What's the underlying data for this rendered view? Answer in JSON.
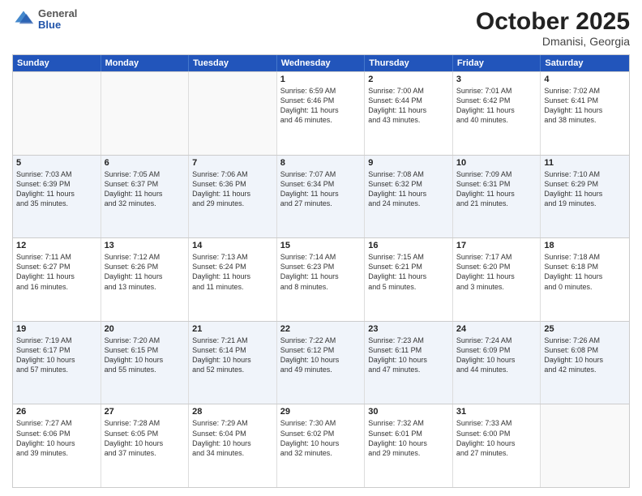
{
  "header": {
    "logo_general": "General",
    "logo_blue": "Blue",
    "month_title": "October 2025",
    "location": "Dmanisi, Georgia"
  },
  "calendar": {
    "days_of_week": [
      "Sunday",
      "Monday",
      "Tuesday",
      "Wednesday",
      "Thursday",
      "Friday",
      "Saturday"
    ],
    "rows": [
      {
        "alt": false,
        "cells": [
          {
            "day": "",
            "info": ""
          },
          {
            "day": "",
            "info": ""
          },
          {
            "day": "",
            "info": ""
          },
          {
            "day": "1",
            "info": "Sunrise: 6:59 AM\nSunset: 6:46 PM\nDaylight: 11 hours\nand 46 minutes."
          },
          {
            "day": "2",
            "info": "Sunrise: 7:00 AM\nSunset: 6:44 PM\nDaylight: 11 hours\nand 43 minutes."
          },
          {
            "day": "3",
            "info": "Sunrise: 7:01 AM\nSunset: 6:42 PM\nDaylight: 11 hours\nand 40 minutes."
          },
          {
            "day": "4",
            "info": "Sunrise: 7:02 AM\nSunset: 6:41 PM\nDaylight: 11 hours\nand 38 minutes."
          }
        ]
      },
      {
        "alt": true,
        "cells": [
          {
            "day": "5",
            "info": "Sunrise: 7:03 AM\nSunset: 6:39 PM\nDaylight: 11 hours\nand 35 minutes."
          },
          {
            "day": "6",
            "info": "Sunrise: 7:05 AM\nSunset: 6:37 PM\nDaylight: 11 hours\nand 32 minutes."
          },
          {
            "day": "7",
            "info": "Sunrise: 7:06 AM\nSunset: 6:36 PM\nDaylight: 11 hours\nand 29 minutes."
          },
          {
            "day": "8",
            "info": "Sunrise: 7:07 AM\nSunset: 6:34 PM\nDaylight: 11 hours\nand 27 minutes."
          },
          {
            "day": "9",
            "info": "Sunrise: 7:08 AM\nSunset: 6:32 PM\nDaylight: 11 hours\nand 24 minutes."
          },
          {
            "day": "10",
            "info": "Sunrise: 7:09 AM\nSunset: 6:31 PM\nDaylight: 11 hours\nand 21 minutes."
          },
          {
            "day": "11",
            "info": "Sunrise: 7:10 AM\nSunset: 6:29 PM\nDaylight: 11 hours\nand 19 minutes."
          }
        ]
      },
      {
        "alt": false,
        "cells": [
          {
            "day": "12",
            "info": "Sunrise: 7:11 AM\nSunset: 6:27 PM\nDaylight: 11 hours\nand 16 minutes."
          },
          {
            "day": "13",
            "info": "Sunrise: 7:12 AM\nSunset: 6:26 PM\nDaylight: 11 hours\nand 13 minutes."
          },
          {
            "day": "14",
            "info": "Sunrise: 7:13 AM\nSunset: 6:24 PM\nDaylight: 11 hours\nand 11 minutes."
          },
          {
            "day": "15",
            "info": "Sunrise: 7:14 AM\nSunset: 6:23 PM\nDaylight: 11 hours\nand 8 minutes."
          },
          {
            "day": "16",
            "info": "Sunrise: 7:15 AM\nSunset: 6:21 PM\nDaylight: 11 hours\nand 5 minutes."
          },
          {
            "day": "17",
            "info": "Sunrise: 7:17 AM\nSunset: 6:20 PM\nDaylight: 11 hours\nand 3 minutes."
          },
          {
            "day": "18",
            "info": "Sunrise: 7:18 AM\nSunset: 6:18 PM\nDaylight: 11 hours\nand 0 minutes."
          }
        ]
      },
      {
        "alt": true,
        "cells": [
          {
            "day": "19",
            "info": "Sunrise: 7:19 AM\nSunset: 6:17 PM\nDaylight: 10 hours\nand 57 minutes."
          },
          {
            "day": "20",
            "info": "Sunrise: 7:20 AM\nSunset: 6:15 PM\nDaylight: 10 hours\nand 55 minutes."
          },
          {
            "day": "21",
            "info": "Sunrise: 7:21 AM\nSunset: 6:14 PM\nDaylight: 10 hours\nand 52 minutes."
          },
          {
            "day": "22",
            "info": "Sunrise: 7:22 AM\nSunset: 6:12 PM\nDaylight: 10 hours\nand 49 minutes."
          },
          {
            "day": "23",
            "info": "Sunrise: 7:23 AM\nSunset: 6:11 PM\nDaylight: 10 hours\nand 47 minutes."
          },
          {
            "day": "24",
            "info": "Sunrise: 7:24 AM\nSunset: 6:09 PM\nDaylight: 10 hours\nand 44 minutes."
          },
          {
            "day": "25",
            "info": "Sunrise: 7:26 AM\nSunset: 6:08 PM\nDaylight: 10 hours\nand 42 minutes."
          }
        ]
      },
      {
        "alt": false,
        "cells": [
          {
            "day": "26",
            "info": "Sunrise: 7:27 AM\nSunset: 6:06 PM\nDaylight: 10 hours\nand 39 minutes."
          },
          {
            "day": "27",
            "info": "Sunrise: 7:28 AM\nSunset: 6:05 PM\nDaylight: 10 hours\nand 37 minutes."
          },
          {
            "day": "28",
            "info": "Sunrise: 7:29 AM\nSunset: 6:04 PM\nDaylight: 10 hours\nand 34 minutes."
          },
          {
            "day": "29",
            "info": "Sunrise: 7:30 AM\nSunset: 6:02 PM\nDaylight: 10 hours\nand 32 minutes."
          },
          {
            "day": "30",
            "info": "Sunrise: 7:32 AM\nSunset: 6:01 PM\nDaylight: 10 hours\nand 29 minutes."
          },
          {
            "day": "31",
            "info": "Sunrise: 7:33 AM\nSunset: 6:00 PM\nDaylight: 10 hours\nand 27 minutes."
          },
          {
            "day": "",
            "info": ""
          }
        ]
      }
    ]
  }
}
